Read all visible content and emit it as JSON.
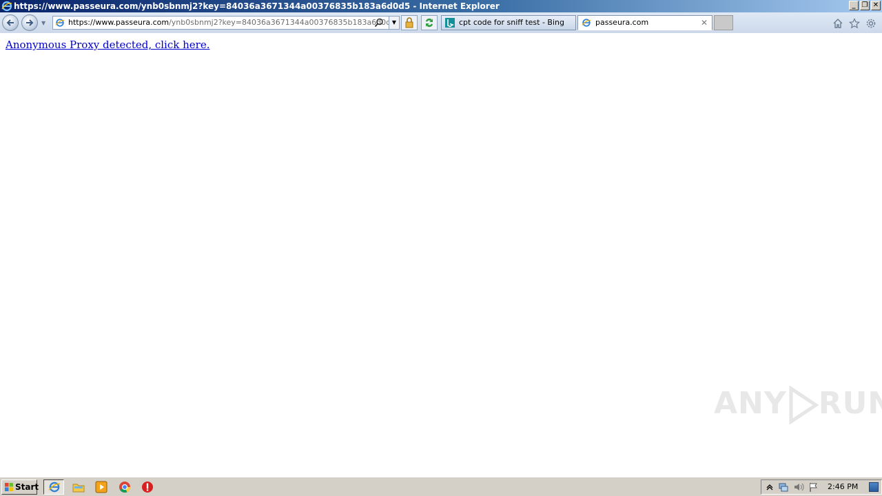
{
  "window": {
    "title": "https://www.passeura.com/ynb0sbnmj2?key=84036a3671344a00376835b183a6d0d5 - Internet Explorer"
  },
  "address_bar": {
    "url_prefix": "https://www.",
    "url_host": "passeura.com",
    "url_rest": "/ynb0sbnmj2?key=84036a3671344a00376835b183a6d0d5"
  },
  "tabs": [
    {
      "label": "cpt code for sniff test - Bing",
      "icon": "bing-icon",
      "active": false
    },
    {
      "label": "passeura.com",
      "icon": "ie-page-icon",
      "active": true
    }
  ],
  "page": {
    "link_text": "Anonymous Proxy detected, click here."
  },
  "watermark": {
    "left": "ANY",
    "right": "RUN"
  },
  "taskbar": {
    "start_label": "Start",
    "clock": "2:46 PM"
  },
  "colors": {
    "link": "#0000cc",
    "titlebar_start": "#0a246a",
    "taskbar": "#d4d0c8"
  }
}
